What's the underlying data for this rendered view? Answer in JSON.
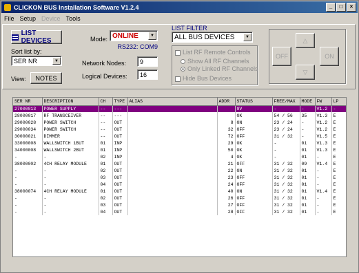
{
  "window": {
    "title": "CLICKON BUS Installation Software V1.2.4"
  },
  "menu": [
    "File",
    "Setup",
    "Device",
    "Tools"
  ],
  "controls": {
    "list_devices_label": "LIST DEVICES",
    "sort_label": "Sort list by:",
    "sort_value": "SER NR",
    "view_label": "View:",
    "view_value": "NOTES",
    "mode_label": "Mode:",
    "mode_value": "ONLINE",
    "port_value": "RS232: COM9",
    "network_nodes_label": "Network Nodes:",
    "network_nodes_value": "9",
    "logical_devices_label": "Logical Devices:",
    "logical_devices_value": "16"
  },
  "filter": {
    "title": "LIST FILTER",
    "value": "ALL BUS DEVICES",
    "list_rf_label": "List RF Remote Controls",
    "show_all_rf_label": "Show All RF Channels",
    "only_linked_rf_label": "Only Linked RF Channels",
    "hide_bus_label": "Hide Bus Devices"
  },
  "nav": {
    "off_label": "OFF",
    "on_label": "ON"
  },
  "table": {
    "headers": [
      "SER NR",
      "DESCRIPTION",
      "CH",
      "TYPE",
      "ALIAS",
      "ADDR",
      "STATUS",
      "FREE/MAX",
      "MODE",
      "FW",
      "LP"
    ],
    "rows": [
      [
        "27000013",
        "POWER SUPPLY",
        "--",
        "---",
        "",
        "",
        "9V",
        "-",
        "-",
        "V1.2",
        "-"
      ],
      [
        "28000017",
        "RF TRANSCEIVER",
        "--",
        "---",
        "",
        "",
        "OK",
        "54 / 56",
        "35",
        "V1.3",
        "E"
      ],
      [
        "29000028",
        "POWER SWITCH",
        "--",
        "OUT",
        "",
        "8",
        "ON",
        "23 / 24",
        "-",
        "V1.2",
        "E"
      ],
      [
        "29000034",
        "POWER SWITCH",
        "--",
        "OUT",
        "",
        "32",
        "OFF",
        "23 / 24",
        "-",
        "V1.2",
        "E"
      ],
      [
        "30000021",
        "DIMMER",
        "--",
        "OUT",
        "",
        "72",
        "OFF",
        "31 / 32",
        "-",
        "V1.5",
        "E"
      ],
      [
        "33000008",
        "WALLSWITCH 1BUT",
        "01",
        "INP",
        "",
        "29",
        "OK",
        "-",
        "01",
        "V1.3",
        "E"
      ],
      [
        "34000008",
        "WALLSWITCH 2BUT",
        "01",
        "INP",
        "",
        "50",
        "OK",
        "-",
        "01",
        "V1.3",
        "E"
      ],
      [
        "-",
        "-",
        "02",
        "INP",
        "",
        "4",
        "OK",
        "-",
        "01",
        "-",
        "E"
      ],
      [
        "38000002",
        "4CH RELAY MODULE",
        "01",
        "OUT",
        "",
        "21",
        "OFF",
        "31 / 32",
        "09",
        "V1.4",
        "E"
      ],
      [
        "-",
        "-",
        "02",
        "OUT",
        "",
        "22",
        "ON",
        "31 / 32",
        "01",
        "-",
        "E"
      ],
      [
        "-",
        "-",
        "03",
        "OUT",
        "",
        "23",
        "OFF",
        "31 / 32",
        "01",
        "-",
        "E"
      ],
      [
        "-",
        "-",
        "04",
        "OUT",
        "",
        "24",
        "OFF",
        "31 / 32",
        "01",
        "-",
        "E"
      ],
      [
        "38000074",
        "4CH RELAY MODULE",
        "01",
        "OUT",
        "",
        "40",
        "ON",
        "31 / 32",
        "01",
        "V1.4",
        "E"
      ],
      [
        "-",
        "-",
        "02",
        "OUT",
        "",
        "26",
        "OFF",
        "31 / 32",
        "01",
        "-",
        "E"
      ],
      [
        "-",
        "-",
        "03",
        "OUT",
        "",
        "27",
        "OFF",
        "31 / 32",
        "01",
        "-",
        "E"
      ],
      [
        "-",
        "-",
        "04",
        "OUT",
        "",
        "28",
        "OFF",
        "31 / 32",
        "01",
        "-",
        "E"
      ]
    ]
  },
  "colors": {
    "selected_row": "#800080",
    "mode_text": "#cc0000",
    "title_bar": "#0a246a"
  }
}
